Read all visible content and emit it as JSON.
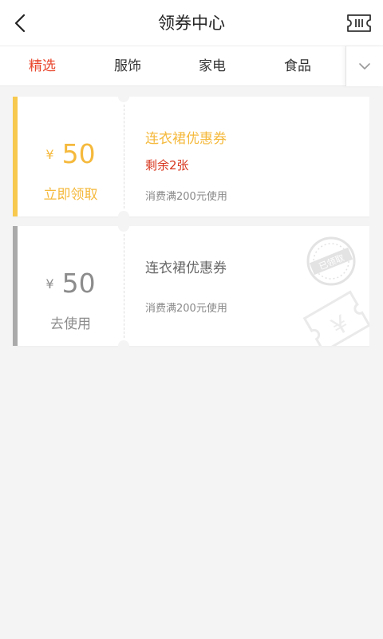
{
  "header": {
    "title": "领券中心",
    "back_icon": "chevron-left-icon",
    "ticket_icon": "ticket-icon"
  },
  "tabs": [
    {
      "label": "精选",
      "active": true
    },
    {
      "label": "服饰",
      "active": false
    },
    {
      "label": "家电",
      "active": false
    },
    {
      "label": "食品",
      "active": false
    }
  ],
  "tabs_more_icon": "chevron-down-icon",
  "coupons": [
    {
      "currency": "¥",
      "amount": "50",
      "action": "立即领取",
      "name": "连衣裙优惠券",
      "remaining": "剩余2张",
      "condition": "消费满200元使用",
      "status": "available",
      "accent_color": "#f5b93c"
    },
    {
      "currency": "¥",
      "amount": "50",
      "action": "去使用",
      "name": "连衣裙优惠券",
      "condition": "消费满200元使用",
      "status": "claimed",
      "stamp_text": "已领取",
      "watermark_text": "¥",
      "accent_color": "#aaaaaa"
    }
  ],
  "colors": {
    "active_tab": "#e8452b",
    "background": "#f4f4f4",
    "remaining_red": "#d8371f"
  }
}
